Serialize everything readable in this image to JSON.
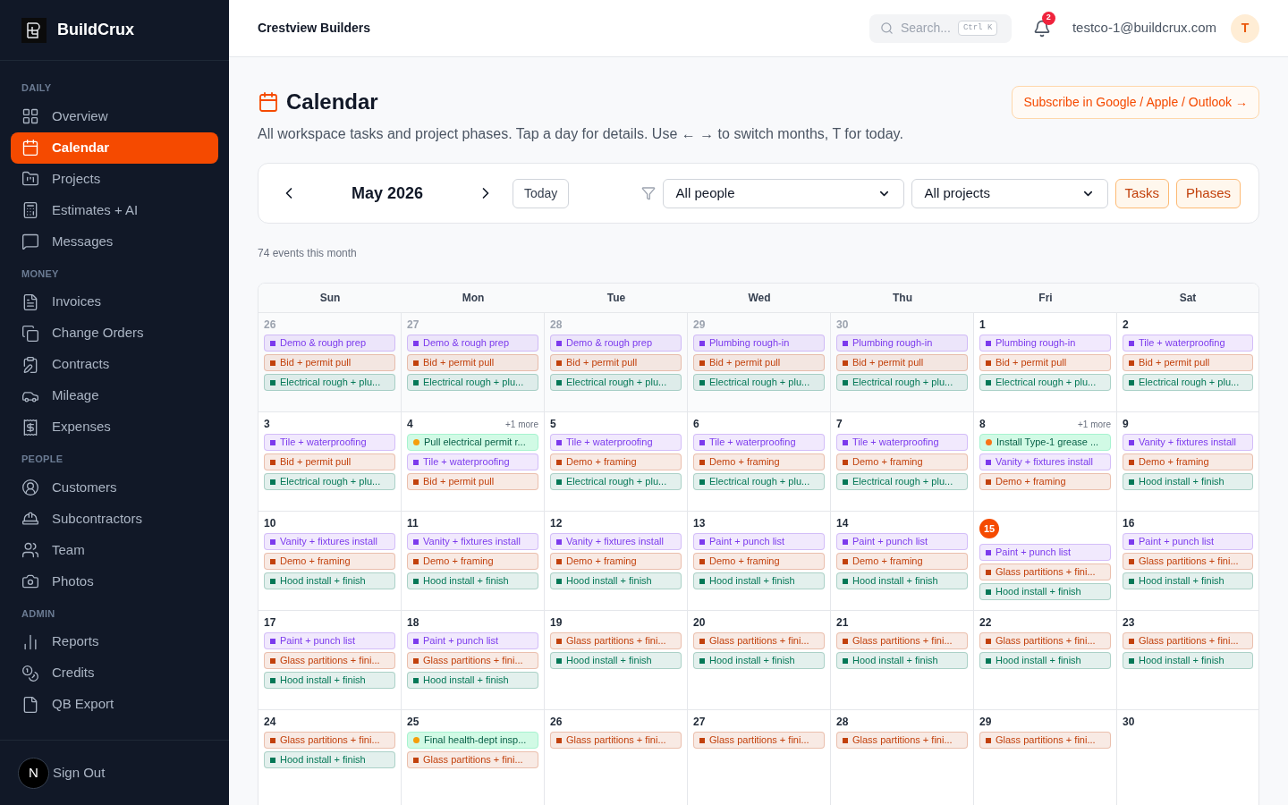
{
  "brand": {
    "name": "BuildCrux"
  },
  "sidebar": {
    "sections": [
      {
        "heading": "DAILY",
        "items": [
          {
            "label": "Overview",
            "selected": false
          },
          {
            "label": "Calendar",
            "selected": true
          },
          {
            "label": "Projects",
            "selected": false
          },
          {
            "label": "Estimates + AI",
            "selected": false
          },
          {
            "label": "Messages",
            "selected": false
          }
        ]
      },
      {
        "heading": "MONEY",
        "items": [
          {
            "label": "Invoices",
            "selected": false
          },
          {
            "label": "Change Orders",
            "selected": false
          },
          {
            "label": "Contracts",
            "selected": false
          },
          {
            "label": "Mileage",
            "selected": false
          },
          {
            "label": "Expenses",
            "selected": false
          }
        ]
      },
      {
        "heading": "PEOPLE",
        "items": [
          {
            "label": "Customers",
            "selected": false
          },
          {
            "label": "Subcontractors",
            "selected": false
          },
          {
            "label": "Team",
            "selected": false
          },
          {
            "label": "Photos",
            "selected": false
          }
        ]
      },
      {
        "heading": "ADMIN",
        "items": [
          {
            "label": "Reports",
            "selected": false
          },
          {
            "label": "Credits",
            "selected": false
          },
          {
            "label": "QB Export",
            "selected": false
          }
        ]
      }
    ],
    "footer": {
      "avatar": "N",
      "label": "Sign Out"
    }
  },
  "header": {
    "company": "Crestview Builders",
    "search": {
      "placeholder": "Search...",
      "shortcut": "Ctrl K"
    },
    "notifications": "2",
    "email": "testco-1@buildcrux.com",
    "avatar": "T"
  },
  "page": {
    "title": "Calendar",
    "subtitle": "All workspace tasks and project phases. Tap a day for details. Use ← → to switch months, T for today.",
    "subscribe": "Subscribe in Google / Apple / Outlook →"
  },
  "toolbar": {
    "month": "May 2026",
    "today": "Today",
    "people": "All people",
    "projects": "All projects",
    "toggles": [
      {
        "label": "Tasks",
        "on": true
      },
      {
        "label": "Phases",
        "on": true
      }
    ]
  },
  "summary": "74 events this month",
  "calendar": {
    "weekdays": [
      "Sun",
      "Mon",
      "Tue",
      "Wed",
      "Thu",
      "Fri",
      "Sat"
    ],
    "weeks": [
      [
        {
          "date": "26",
          "muted": true,
          "today": false,
          "events": [
            {
              "kind": "phase",
              "label": "Demo & rough prep",
              "color": "#7c3aed"
            },
            {
              "kind": "phase",
              "label": "Bid + permit pull",
              "color": "#c2410c"
            },
            {
              "kind": "phase",
              "label": "Electrical rough + plu...",
              "color": "#047857"
            }
          ]
        },
        {
          "date": "27",
          "muted": true,
          "today": false,
          "events": [
            {
              "kind": "phase",
              "label": "Demo & rough prep",
              "color": "#7c3aed"
            },
            {
              "kind": "phase",
              "label": "Bid + permit pull",
              "color": "#c2410c"
            },
            {
              "kind": "phase",
              "label": "Electrical rough + plu...",
              "color": "#047857"
            }
          ]
        },
        {
          "date": "28",
          "muted": true,
          "today": false,
          "events": [
            {
              "kind": "phase",
              "label": "Demo & rough prep",
              "color": "#7c3aed"
            },
            {
              "kind": "phase",
              "label": "Bid + permit pull",
              "color": "#c2410c"
            },
            {
              "kind": "phase",
              "label": "Electrical rough + plu...",
              "color": "#047857"
            }
          ]
        },
        {
          "date": "29",
          "muted": true,
          "today": false,
          "events": [
            {
              "kind": "phase",
              "label": "Plumbing rough-in",
              "color": "#7c3aed"
            },
            {
              "kind": "phase",
              "label": "Bid + permit pull",
              "color": "#c2410c"
            },
            {
              "kind": "phase",
              "label": "Electrical rough + plu...",
              "color": "#047857"
            }
          ]
        },
        {
          "date": "30",
          "muted": true,
          "today": false,
          "events": [
            {
              "kind": "phase",
              "label": "Plumbing rough-in",
              "color": "#7c3aed"
            },
            {
              "kind": "phase",
              "label": "Bid + permit pull",
              "color": "#c2410c"
            },
            {
              "kind": "phase",
              "label": "Electrical rough + plu...",
              "color": "#047857"
            }
          ]
        },
        {
          "date": "1",
          "muted": false,
          "today": false,
          "events": [
            {
              "kind": "phase",
              "label": "Plumbing rough-in",
              "color": "#7c3aed"
            },
            {
              "kind": "phase",
              "label": "Bid + permit pull",
              "color": "#c2410c"
            },
            {
              "kind": "phase",
              "label": "Electrical rough + plu...",
              "color": "#047857"
            }
          ]
        },
        {
          "date": "2",
          "muted": false,
          "today": false,
          "events": [
            {
              "kind": "phase",
              "label": "Tile + waterproofing",
              "color": "#7c3aed"
            },
            {
              "kind": "phase",
              "label": "Bid + permit pull",
              "color": "#c2410c"
            },
            {
              "kind": "phase",
              "label": "Electrical rough + plu...",
              "color": "#047857"
            }
          ]
        }
      ],
      [
        {
          "date": "3",
          "muted": false,
          "today": false,
          "events": [
            {
              "kind": "phase",
              "label": "Tile + waterproofing",
              "color": "#7c3aed"
            },
            {
              "kind": "phase",
              "label": "Bid + permit pull",
              "color": "#c2410c"
            },
            {
              "kind": "phase",
              "label": "Electrical rough + plu...",
              "color": "#047857"
            }
          ]
        },
        {
          "date": "4",
          "muted": false,
          "today": false,
          "more": "+1 more",
          "events": [
            {
              "kind": "task",
              "label": "Pull electrical permit r...",
              "color": "#f59e0b"
            },
            {
              "kind": "phase",
              "label": "Tile + waterproofing",
              "color": "#7c3aed"
            },
            {
              "kind": "phase",
              "label": "Bid + permit pull",
              "color": "#c2410c"
            }
          ]
        },
        {
          "date": "5",
          "muted": false,
          "today": false,
          "events": [
            {
              "kind": "phase",
              "label": "Tile + waterproofing",
              "color": "#7c3aed"
            },
            {
              "kind": "phase",
              "label": "Demo + framing",
              "color": "#c2410c"
            },
            {
              "kind": "phase",
              "label": "Electrical rough + plu...",
              "color": "#047857"
            }
          ]
        },
        {
          "date": "6",
          "muted": false,
          "today": false,
          "events": [
            {
              "kind": "phase",
              "label": "Tile + waterproofing",
              "color": "#7c3aed"
            },
            {
              "kind": "phase",
              "label": "Demo + framing",
              "color": "#c2410c"
            },
            {
              "kind": "phase",
              "label": "Electrical rough + plu...",
              "color": "#047857"
            }
          ]
        },
        {
          "date": "7",
          "muted": false,
          "today": false,
          "events": [
            {
              "kind": "phase",
              "label": "Tile + waterproofing",
              "color": "#7c3aed"
            },
            {
              "kind": "phase",
              "label": "Demo + framing",
              "color": "#c2410c"
            },
            {
              "kind": "phase",
              "label": "Electrical rough + plu...",
              "color": "#047857"
            }
          ]
        },
        {
          "date": "8",
          "muted": false,
          "today": false,
          "more": "+1 more",
          "events": [
            {
              "kind": "task",
              "label": "Install Type-1 grease ...",
              "color": "#f97316"
            },
            {
              "kind": "phase",
              "label": "Vanity + fixtures install",
              "color": "#7c3aed"
            },
            {
              "kind": "phase",
              "label": "Demo + framing",
              "color": "#c2410c"
            }
          ]
        },
        {
          "date": "9",
          "muted": false,
          "today": false,
          "events": [
            {
              "kind": "phase",
              "label": "Vanity + fixtures install",
              "color": "#7c3aed"
            },
            {
              "kind": "phase",
              "label": "Demo + framing",
              "color": "#c2410c"
            },
            {
              "kind": "phase",
              "label": "Hood install + finish",
              "color": "#047857"
            }
          ]
        }
      ],
      [
        {
          "date": "10",
          "muted": false,
          "today": false,
          "events": [
            {
              "kind": "phase",
              "label": "Vanity + fixtures install",
              "color": "#7c3aed"
            },
            {
              "kind": "phase",
              "label": "Demo + framing",
              "color": "#c2410c"
            },
            {
              "kind": "phase",
              "label": "Hood install + finish",
              "color": "#047857"
            }
          ]
        },
        {
          "date": "11",
          "muted": false,
          "today": false,
          "events": [
            {
              "kind": "phase",
              "label": "Vanity + fixtures install",
              "color": "#7c3aed"
            },
            {
              "kind": "phase",
              "label": "Demo + framing",
              "color": "#c2410c"
            },
            {
              "kind": "phase",
              "label": "Hood install + finish",
              "color": "#047857"
            }
          ]
        },
        {
          "date": "12",
          "muted": false,
          "today": false,
          "events": [
            {
              "kind": "phase",
              "label": "Vanity + fixtures install",
              "color": "#7c3aed"
            },
            {
              "kind": "phase",
              "label": "Demo + framing",
              "color": "#c2410c"
            },
            {
              "kind": "phase",
              "label": "Hood install + finish",
              "color": "#047857"
            }
          ]
        },
        {
          "date": "13",
          "muted": false,
          "today": false,
          "events": [
            {
              "kind": "phase",
              "label": "Paint + punch list",
              "color": "#7c3aed"
            },
            {
              "kind": "phase",
              "label": "Demo + framing",
              "color": "#c2410c"
            },
            {
              "kind": "phase",
              "label": "Hood install + finish",
              "color": "#047857"
            }
          ]
        },
        {
          "date": "14",
          "muted": false,
          "today": false,
          "events": [
            {
              "kind": "phase",
              "label": "Paint + punch list",
              "color": "#7c3aed"
            },
            {
              "kind": "phase",
              "label": "Demo + framing",
              "color": "#c2410c"
            },
            {
              "kind": "phase",
              "label": "Hood install + finish",
              "color": "#047857"
            }
          ]
        },
        {
          "date": "15",
          "muted": false,
          "today": true,
          "events": [
            {
              "kind": "phase",
              "label": "Paint + punch list",
              "color": "#7c3aed"
            },
            {
              "kind": "phase",
              "label": "Glass partitions + fini...",
              "color": "#c2410c"
            },
            {
              "kind": "phase",
              "label": "Hood install + finish",
              "color": "#047857"
            }
          ]
        },
        {
          "date": "16",
          "muted": false,
          "today": false,
          "events": [
            {
              "kind": "phase",
              "label": "Paint + punch list",
              "color": "#7c3aed"
            },
            {
              "kind": "phase",
              "label": "Glass partitions + fini...",
              "color": "#c2410c"
            },
            {
              "kind": "phase",
              "label": "Hood install + finish",
              "color": "#047857"
            }
          ]
        }
      ],
      [
        {
          "date": "17",
          "muted": false,
          "today": false,
          "events": [
            {
              "kind": "phase",
              "label": "Paint + punch list",
              "color": "#7c3aed"
            },
            {
              "kind": "phase",
              "label": "Glass partitions + fini...",
              "color": "#c2410c"
            },
            {
              "kind": "phase",
              "label": "Hood install + finish",
              "color": "#047857"
            }
          ]
        },
        {
          "date": "18",
          "muted": false,
          "today": false,
          "events": [
            {
              "kind": "phase",
              "label": "Paint + punch list",
              "color": "#7c3aed"
            },
            {
              "kind": "phase",
              "label": "Glass partitions + fini...",
              "color": "#c2410c"
            },
            {
              "kind": "phase",
              "label": "Hood install + finish",
              "color": "#047857"
            }
          ]
        },
        {
          "date": "19",
          "muted": false,
          "today": false,
          "events": [
            {
              "kind": "phase",
              "label": "Glass partitions + fini...",
              "color": "#c2410c"
            },
            {
              "kind": "phase",
              "label": "Hood install + finish",
              "color": "#047857"
            }
          ]
        },
        {
          "date": "20",
          "muted": false,
          "today": false,
          "events": [
            {
              "kind": "phase",
              "label": "Glass partitions + fini...",
              "color": "#c2410c"
            },
            {
              "kind": "phase",
              "label": "Hood install + finish",
              "color": "#047857"
            }
          ]
        },
        {
          "date": "21",
          "muted": false,
          "today": false,
          "events": [
            {
              "kind": "phase",
              "label": "Glass partitions + fini...",
              "color": "#c2410c"
            },
            {
              "kind": "phase",
              "label": "Hood install + finish",
              "color": "#047857"
            }
          ]
        },
        {
          "date": "22",
          "muted": false,
          "today": false,
          "events": [
            {
              "kind": "phase",
              "label": "Glass partitions + fini...",
              "color": "#c2410c"
            },
            {
              "kind": "phase",
              "label": "Hood install + finish",
              "color": "#047857"
            }
          ]
        },
        {
          "date": "23",
          "muted": false,
          "today": false,
          "events": [
            {
              "kind": "phase",
              "label": "Glass partitions + fini...",
              "color": "#c2410c"
            },
            {
              "kind": "phase",
              "label": "Hood install + finish",
              "color": "#047857"
            }
          ]
        }
      ],
      [
        {
          "date": "24",
          "muted": false,
          "today": false,
          "events": [
            {
              "kind": "phase",
              "label": "Glass partitions + fini...",
              "color": "#c2410c"
            },
            {
              "kind": "phase",
              "label": "Hood install + finish",
              "color": "#047857"
            }
          ]
        },
        {
          "date": "25",
          "muted": false,
          "today": false,
          "events": [
            {
              "kind": "task",
              "label": "Final health-dept insp...",
              "color": "#f59e0b"
            },
            {
              "kind": "phase",
              "label": "Glass partitions + fini...",
              "color": "#c2410c"
            }
          ]
        },
        {
          "date": "26",
          "muted": false,
          "today": false,
          "events": [
            {
              "kind": "phase",
              "label": "Glass partitions + fini...",
              "color": "#c2410c"
            }
          ]
        },
        {
          "date": "27",
          "muted": false,
          "today": false,
          "events": [
            {
              "kind": "phase",
              "label": "Glass partitions + fini...",
              "color": "#c2410c"
            }
          ]
        },
        {
          "date": "28",
          "muted": false,
          "today": false,
          "events": [
            {
              "kind": "phase",
              "label": "Glass partitions + fini...",
              "color": "#c2410c"
            }
          ]
        },
        {
          "date": "29",
          "muted": false,
          "today": false,
          "events": [
            {
              "kind": "phase",
              "label": "Glass partitions + fini...",
              "color": "#c2410c"
            }
          ]
        },
        {
          "date": "30",
          "muted": false,
          "today": false
        }
      ]
    ]
  }
}
